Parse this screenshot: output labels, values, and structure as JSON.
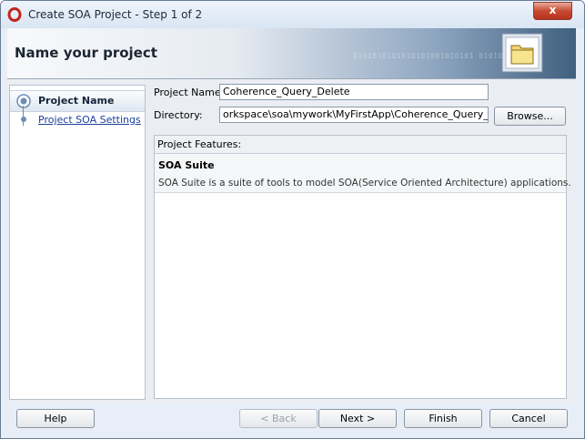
{
  "window": {
    "title": "Create SOA Project - Step 1 of 2",
    "close_label": "x"
  },
  "header": {
    "title": "Name your project",
    "binary_text": "0101010101010101001010101 0101010101"
  },
  "steps": [
    {
      "label": "Project Name",
      "state": "active"
    },
    {
      "label": "Project SOA Settings",
      "state": "link"
    }
  ],
  "form": {
    "project_name_label": "Project Name:",
    "project_name_value": "Coherence_Query_Delete",
    "directory_label": "Directory:",
    "directory_value": "orkspace\\soa\\mywork\\MyFirstApp\\Coherence_Query_Delete",
    "browse_label": "Browse..."
  },
  "features": {
    "header": "Project Features:",
    "items": [
      {
        "name": "SOA Suite",
        "description": "SOA Suite is a suite of tools to model SOA(Service Oriented Architecture) applications."
      }
    ]
  },
  "buttons": {
    "help": "Help",
    "back": "< Back",
    "next": "Next >",
    "finish": "Finish",
    "cancel": "Cancel"
  },
  "colors": {
    "accent": "#3f607f",
    "link": "#1c3f9a",
    "close": "#c74a33"
  }
}
